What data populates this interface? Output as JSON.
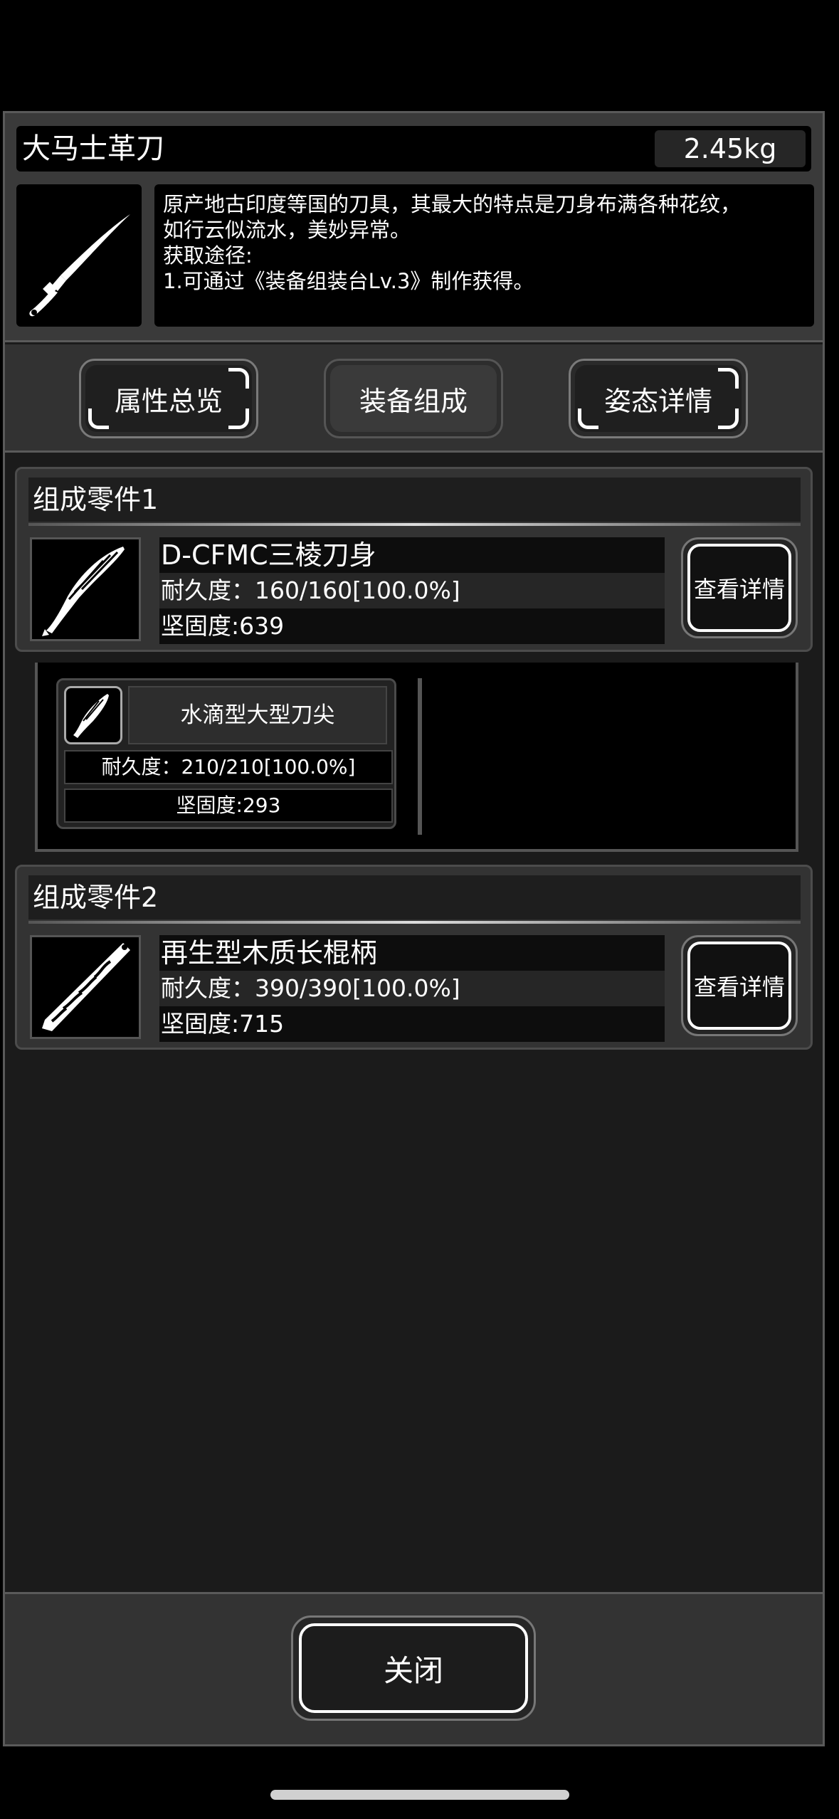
{
  "item": {
    "name": "大马士革刀",
    "weight": "2.45kg",
    "icon": "knife-icon",
    "description": "原产地古印度等国的刀具，其最大的特点是刀身布满各种花纹，\n如行云似流水，美妙异常。\n获取途径:\n1.可通过《装备组装台Lv.3》制作获得。"
  },
  "tabs": [
    {
      "label": "属性总览"
    },
    {
      "label": "装备组成"
    },
    {
      "label": "姿态详情"
    }
  ],
  "components": [
    {
      "header": "组成零件1",
      "icon": "blade-icon",
      "name": "D-CFMC三棱刀身",
      "durability": "耐久度：160/160[100.0%]",
      "hardness": "坚固度:639",
      "detail_label": "查看详情"
    },
    {
      "header": "组成零件2",
      "icon": "wooden-handle-icon",
      "name": "再生型木质长棍柄",
      "durability": "耐久度：390/390[100.0%]",
      "hardness": "坚固度:715",
      "detail_label": "查看详情"
    }
  ],
  "subparts": [
    {
      "icon": "blade-tip-icon",
      "name": "水滴型大型刀尖",
      "durability": "耐久度：210/210[100.0%]",
      "hardness": "坚固度:293"
    }
  ],
  "footer": {
    "close_label": "关闭"
  }
}
